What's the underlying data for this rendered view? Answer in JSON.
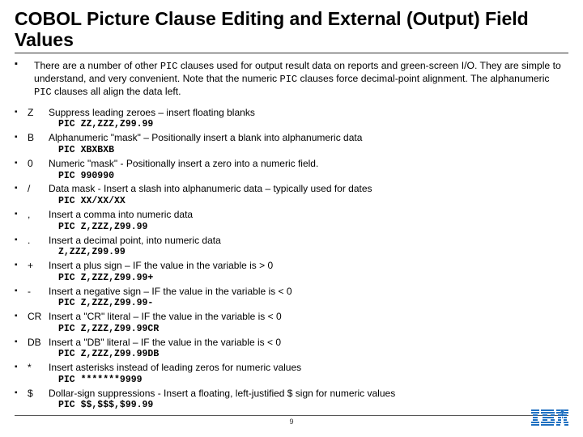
{
  "title": "COBOL Picture Clause Editing and External (Output) Field Values",
  "intro_pre": "There are a number of other ",
  "intro_pic1": "PIC",
  "intro_mid": " clauses used for output result data on reports and green-screen I/O.  They are simple to understand, and very convenient.  Note that the numeric ",
  "intro_pic2": "PIC",
  "intro_mid2": " clauses force decimal-point alignment.  The alphanumeric ",
  "intro_pic3": "PIC",
  "intro_post": " clauses all align the data left.",
  "items": [
    {
      "sym": "Z",
      "desc": "Suppress leading zeroes – insert floating blanks",
      "pic": "PIC ZZ,ZZZ,Z99.99"
    },
    {
      "sym": "B",
      "desc": "Alphanumeric \"mask\" – Positionally insert a blank into alphanumeric data",
      "pic": "PIC XBXBXB"
    },
    {
      "sym": "0",
      "desc": "Numeric \"mask\" - Positionally insert a zero into a numeric field.",
      "pic": "PIC 990990"
    },
    {
      "sym": "/",
      "desc": "Data mask - Insert a slash into alphanumeric data – typically used for dates",
      "pic": "PIC XX/XX/XX"
    },
    {
      "sym": ",",
      "desc": "Insert a comma into numeric data",
      "pic": "PIC Z,ZZZ,Z99.99"
    },
    {
      "sym": ".",
      "desc": "Insert a decimal point, into numeric data",
      "pic": "Z,ZZZ,Z99.99"
    },
    {
      "sym": "+",
      "desc": "Insert a plus sign – IF the value in the variable is > 0",
      "pic": "PIC Z,ZZZ,Z99.99+"
    },
    {
      "sym": "-",
      "desc": "Insert a negative sign – IF the value in the variable is < 0",
      "pic": "PIC Z,ZZZ,Z99.99-"
    },
    {
      "sym": "CR",
      "desc": "Insert a \"CR\" literal – IF the value in the variable is < 0",
      "pic": "PIC Z,ZZZ,Z99.99CR"
    },
    {
      "sym": "DB",
      "desc": "Insert a \"DB\"  literal – IF the value in the variable is < 0",
      "pic": "PIC Z,ZZZ,Z99.99DB"
    },
    {
      "sym": "*",
      "desc": "Insert asterisks instead of leading zeros for numeric values",
      "pic": "PIC *******9999"
    },
    {
      "sym": "$",
      "desc": "Dollar-sign suppressions - Insert a floating, left-justified $ sign for numeric values",
      "pic": "PIC $$,$$$,$99.99"
    }
  ],
  "page_number": "9",
  "logo_name": "IBM"
}
